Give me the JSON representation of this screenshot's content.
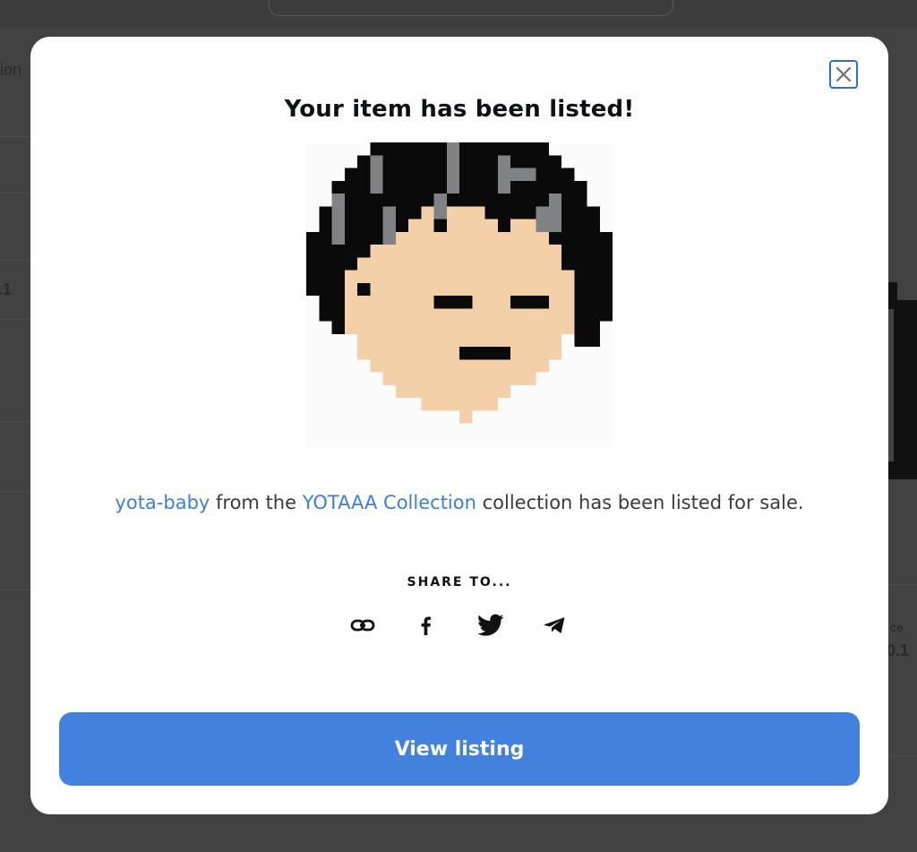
{
  "background": {
    "partial_labels": [
      "ion",
      ".1",
      "ce",
      "0.1"
    ]
  },
  "modal": {
    "title": "Your item has been listed!",
    "close_icon": "close-icon",
    "image_alt": "yota-baby pixel art",
    "description": {
      "item_name": "yota-baby",
      "text_from": " from the ",
      "collection_name": "YOTAAA Collection",
      "text_suffix": " collection has been listed for sale."
    },
    "share": {
      "label": "SHARE TO...",
      "icons": [
        "link-icon",
        "facebook-icon",
        "twitter-icon",
        "telegram-icon"
      ]
    },
    "view_button_label": "View listing"
  },
  "colors": {
    "accent": "#4282de",
    "link": "#3c7ed8",
    "overlay": "#424242",
    "skin": "#f4d0a8",
    "hair": "#0a0a0a",
    "hair_highlight": "#7f8385"
  }
}
